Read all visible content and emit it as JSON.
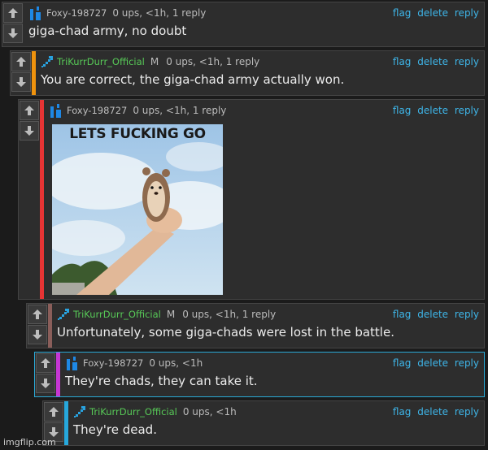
{
  "actions": {
    "flag": "flag",
    "delete": "delete",
    "reply": "reply"
  },
  "colors": {
    "depth": [
      "none",
      "#f0930d",
      "#e63434",
      "#8a5e5a",
      "#c636d3",
      "#27a8dc"
    ],
    "username_green": "#57c957",
    "link": "#3eb5e8"
  },
  "comments": [
    {
      "username": "Foxy-198727",
      "avatar": "blue-bars-avatar-icon",
      "badge": "",
      "stats": "0 ups, <1h, 1 reply",
      "text": "giga-chad army, no doubt"
    },
    {
      "username": "TriKurrDurr_Official",
      "avatar": "blue-pixel-arrow-avatar-icon",
      "badge": "M",
      "stats": "0 ups, <1h, 1 reply",
      "text": "You are correct, the giga-chad army actually won."
    },
    {
      "username": "Foxy-198727",
      "avatar": "blue-bars-avatar-icon",
      "badge": "",
      "stats": "0 ups, <1h, 1 reply",
      "text": "",
      "image_caption": "LETS FUCKING GO",
      "image": "hand-holding-hedgehog-meme-image"
    },
    {
      "username": "TriKurrDurr_Official",
      "avatar": "blue-pixel-arrow-avatar-icon",
      "badge": "M",
      "stats": "0 ups, <1h, 1 reply",
      "text": "Unfortunately, some giga-chads were lost in the battle."
    },
    {
      "username": "Foxy-198727",
      "avatar": "blue-bars-avatar-icon",
      "badge": "",
      "stats": "0 ups, <1h",
      "text": "They're chads, they can take it."
    },
    {
      "username": "TriKurrDurr_Official",
      "avatar": "blue-pixel-arrow-avatar-icon",
      "badge": "",
      "stats": "0 ups, <1h",
      "text": "They're dead."
    }
  ],
  "watermark": "imgflip.com"
}
